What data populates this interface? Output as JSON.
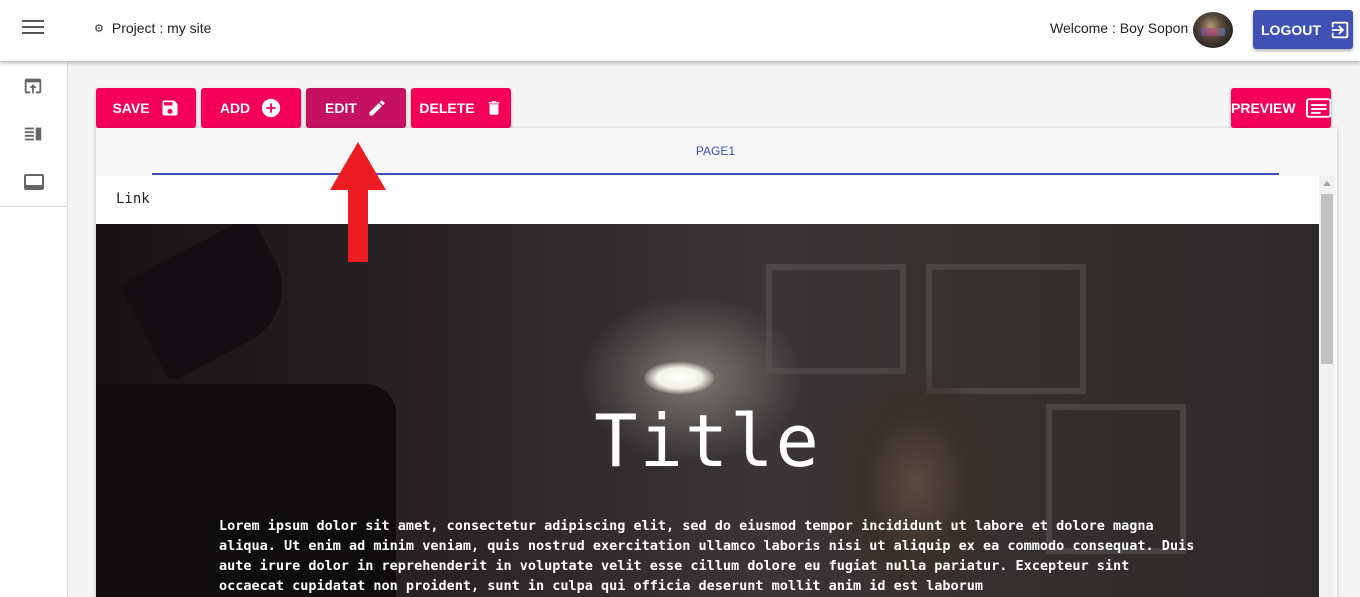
{
  "header": {
    "project_label": "Project : my site",
    "welcome_text": "Welcome : Boy Sopon",
    "logout_label": "LOGOUT"
  },
  "sidebar": {
    "icons": [
      "upload-window-icon",
      "view-list-icon",
      "web-asset-icon"
    ]
  },
  "toolbar": {
    "save_label": "SAVE",
    "add_label": "ADD",
    "edit_label": "EDIT",
    "delete_label": "DELETE",
    "preview_label": "PREVIEW"
  },
  "tabs": [
    {
      "label": "PAGE1",
      "active": true
    }
  ],
  "page": {
    "link_text": "Link",
    "title": "Title",
    "body": "Lorem ipsum dolor sit amet, consectetur adipiscing elit, sed do eiusmod tempor incididunt ut labore et dolore magna aliqua. Ut enim ad minim veniam, quis nostrud exercitation ullamco laboris nisi ut aliquip ex ea commodo consequat. Duis aute irure dolor in reprehenderit in voluptate velit esse cillum dolore eu fugiat nulla pariatur. Excepteur sint occaecat cupidatat non proident, sunt in culpa qui officia deserunt mollit anim id est laborum"
  },
  "colors": {
    "accent_pink": "#f50057",
    "accent_pink_active": "#c51162",
    "primary_indigo": "#3f51b5",
    "annotation_arrow": "#ed1c24"
  }
}
